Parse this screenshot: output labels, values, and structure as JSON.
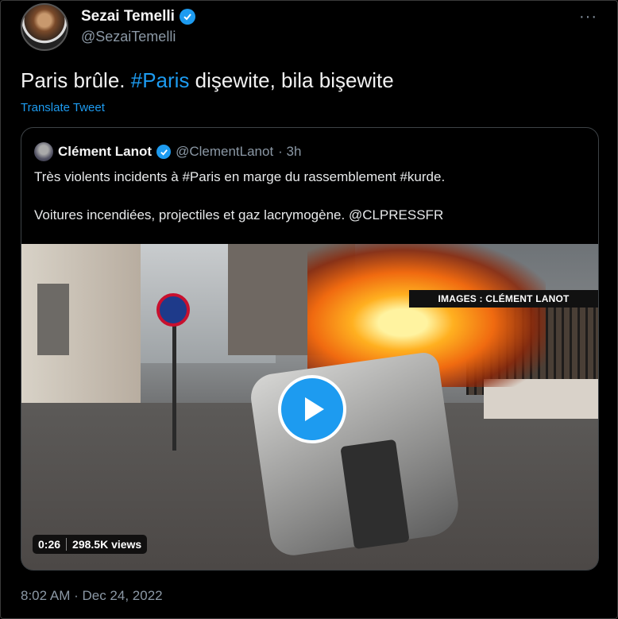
{
  "tweet": {
    "author_name": "Sezai Temelli",
    "author_handle": "@SezaiTemelli",
    "more_label": "···",
    "text_part1": "Paris brûle. ",
    "hashtag": "#Paris",
    "text_part2": " dişewite, bila bişewite",
    "translate_label": "Translate Tweet",
    "timestamp": "8:02 AM · Dec 24, 2022"
  },
  "quoted": {
    "author_name": "Clément Lanot",
    "author_handle": "@ClementLanot",
    "age": "· 3h",
    "line1": "Très violents incidents à #Paris en marge du rassemblement #kurde.",
    "line2": "Voitures incendiées, projectiles et gaz lacrymogène. @CLPRESSFR",
    "media": {
      "watermark": "IMAGES : CLÉMENT LANOT",
      "duration": "0:26",
      "views": "298.5K views"
    }
  },
  "colors": {
    "accent": "#1d9bf0",
    "background": "#000000",
    "secondary_text": "#8b98a5"
  }
}
